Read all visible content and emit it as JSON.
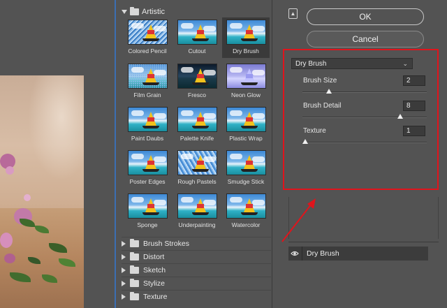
{
  "gallery": {
    "open_category": "Artistic",
    "filters": [
      {
        "label": "Colored Pencil",
        "style": "colored"
      },
      {
        "label": "Cutout",
        "style": "plain"
      },
      {
        "label": "Dry Brush",
        "style": "plain",
        "selected": true
      },
      {
        "label": "Film Grain",
        "style": "grain"
      },
      {
        "label": "Fresco",
        "style": "dark"
      },
      {
        "label": "Neon Glow",
        "style": "neon"
      },
      {
        "label": "Paint Daubs",
        "style": "plain"
      },
      {
        "label": "Palette Knife",
        "style": "plain"
      },
      {
        "label": "Plastic Wrap",
        "style": "plain"
      },
      {
        "label": "Poster Edges",
        "style": "plain"
      },
      {
        "label": "Rough Pastels",
        "style": "rough"
      },
      {
        "label": "Smudge Stick",
        "style": "plain"
      },
      {
        "label": "Sponge",
        "style": "plain"
      },
      {
        "label": "Underpainting",
        "style": "plain"
      },
      {
        "label": "Watercolor",
        "style": "plain"
      }
    ],
    "collapsed_categories": [
      "Brush Strokes",
      "Distort",
      "Sketch",
      "Stylize",
      "Texture"
    ]
  },
  "buttons": {
    "ok_label": "OK",
    "cancel_label": "Cancel"
  },
  "settings": {
    "selected_filter": "Dry Brush",
    "params": [
      {
        "label": "Brush Size",
        "value": "2",
        "min": 0,
        "max": 10,
        "level": 2
      },
      {
        "label": "Brush Detail",
        "value": "8",
        "min": 0,
        "max": 10,
        "level": 8
      },
      {
        "label": "Texture",
        "value": "1",
        "min": 1,
        "max": 3,
        "level": 1
      }
    ]
  },
  "layers": {
    "items": [
      {
        "name": "Dry Brush",
        "visible": true
      }
    ]
  },
  "colors": {
    "highlight_border": "#e0141c",
    "panel_bg": "#535353",
    "preview_frame": "#3b6fb3"
  }
}
